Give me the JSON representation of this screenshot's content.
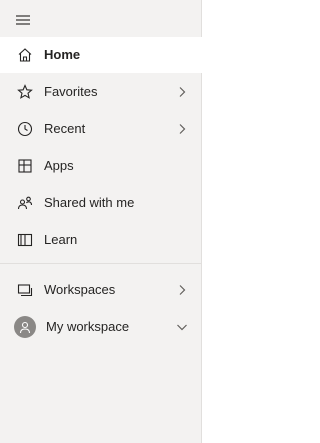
{
  "nav": {
    "menu_icon": "hamburger-menu-icon",
    "items": [
      {
        "label": "Home",
        "icon": "home-icon",
        "active": true,
        "chevron": null
      },
      {
        "label": "Favorites",
        "icon": "star-icon",
        "active": false,
        "chevron": "right"
      },
      {
        "label": "Recent",
        "icon": "clock-icon",
        "active": false,
        "chevron": "right"
      },
      {
        "label": "Apps",
        "icon": "apps-icon",
        "active": false,
        "chevron": null
      },
      {
        "label": "Shared with me",
        "icon": "people-icon",
        "active": false,
        "chevron": null
      },
      {
        "label": "Learn",
        "icon": "book-icon",
        "active": false,
        "chevron": null
      }
    ],
    "workspaces": [
      {
        "label": "Workspaces",
        "icon": "workspaces-icon",
        "chevron": "right"
      },
      {
        "label": "My workspace",
        "icon": "avatar-icon",
        "chevron": "down"
      }
    ]
  },
  "colors": {
    "nav_background": "#f3f2f1",
    "active_background": "#ffffff",
    "text": "#252423",
    "icon": "#252423",
    "avatar_background": "#8a8886",
    "divider": "#e1dfdd"
  }
}
